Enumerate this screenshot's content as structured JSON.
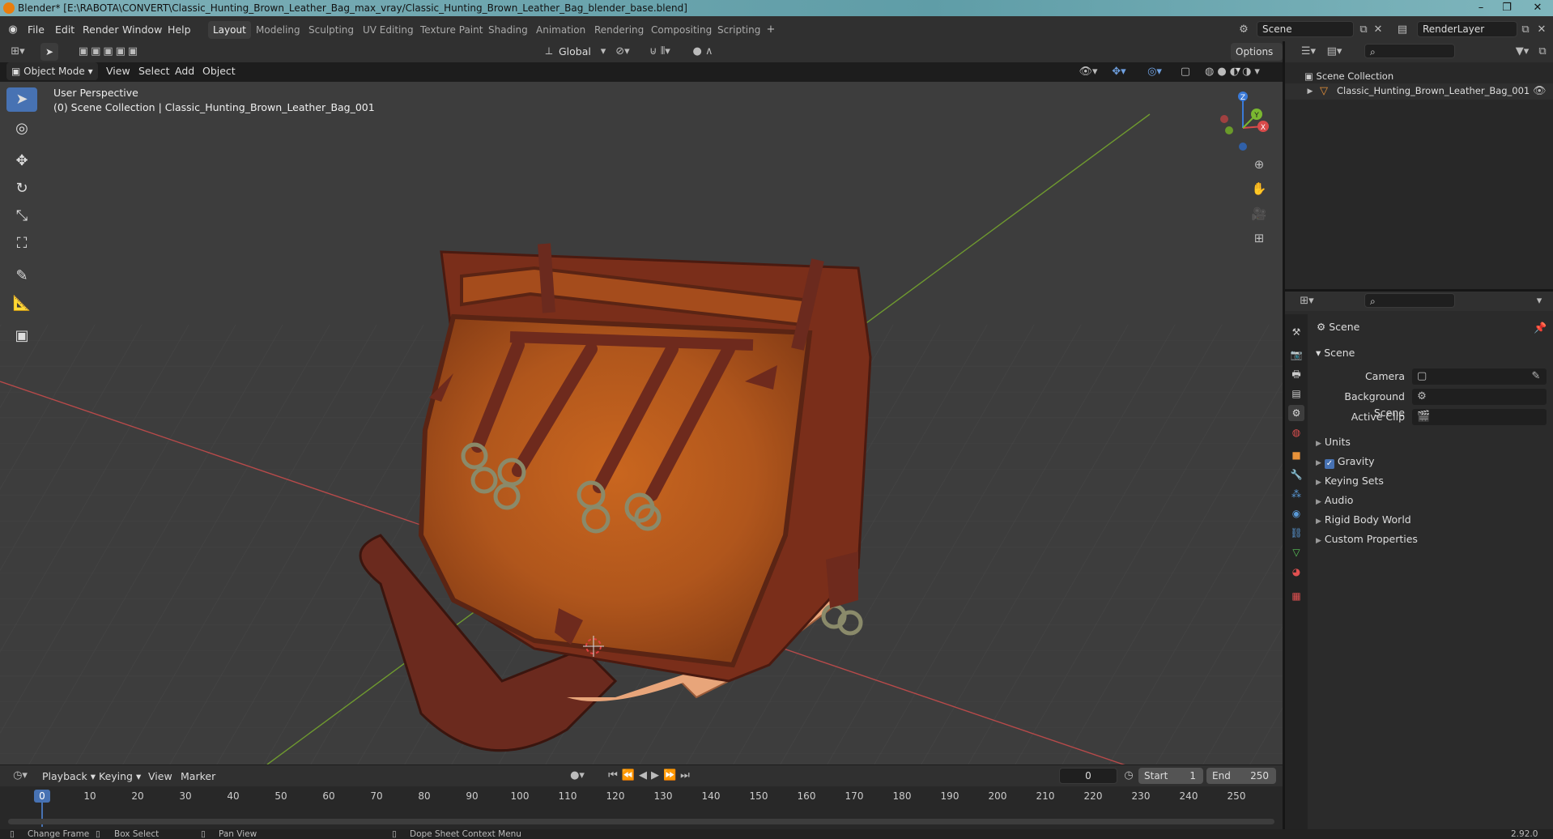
{
  "titlebar": {
    "text": "Blender* [E:\\RABOTA\\CONVERT\\Classic_Hunting_Brown_Leather_Bag_max_vray/Classic_Hunting_Brown_Leather_Bag_blender_base.blend]"
  },
  "menus": [
    "File",
    "Edit",
    "Render",
    "Window",
    "Help"
  ],
  "workspaces": [
    "Layout",
    "Modeling",
    "Sculpting",
    "UV Editing",
    "Texture Paint",
    "Shading",
    "Animation",
    "Rendering",
    "Compositing",
    "Scripting"
  ],
  "topright": {
    "scene": "Scene",
    "renderlayer": "RenderLayer"
  },
  "tool_header": {
    "orientation": "Global",
    "options": "Options"
  },
  "viewport_header": {
    "mode": "Object Mode",
    "menus": [
      "View",
      "Select",
      "Add",
      "Object"
    ]
  },
  "viewport": {
    "perspective": "User Perspective",
    "collection": "(0) Scene Collection | Classic_Hunting_Brown_Leather_Bag_001"
  },
  "outliner": {
    "root": "Scene Collection",
    "items": [
      "Classic_Hunting_Brown_Leather_Bag_001"
    ]
  },
  "properties": {
    "title": "Scene",
    "panel": "Scene",
    "fields": [
      {
        "label": "Camera"
      },
      {
        "label": "Background Scene"
      },
      {
        "label": "Active Clip"
      }
    ],
    "sections": [
      "Units",
      "Gravity",
      "Keying Sets",
      "Audio",
      "Rigid Body World",
      "Custom Properties"
    ]
  },
  "timeline": {
    "menus": [
      "Playback",
      "Keying",
      "View",
      "Marker"
    ],
    "current_frame": "0",
    "start_label": "Start",
    "start": "1",
    "end_label": "End",
    "end": "250",
    "ticks": [
      "0",
      "10",
      "20",
      "30",
      "40",
      "50",
      "60",
      "70",
      "80",
      "90",
      "100",
      "110",
      "120",
      "130",
      "140",
      "150",
      "160",
      "170",
      "180",
      "190",
      "200",
      "210",
      "220",
      "230",
      "240",
      "250"
    ]
  },
  "statusbar": {
    "items": [
      "Change Frame",
      "Box Select",
      "Pan View",
      "Dope Sheet Context Menu"
    ],
    "version": "2.92.0"
  },
  "colors": {
    "accent": "#4772b3",
    "bg": "#3d3d3d",
    "x_axis": "#c94a4a",
    "y_axis": "#7fb83a",
    "leather": "#b5561b"
  }
}
